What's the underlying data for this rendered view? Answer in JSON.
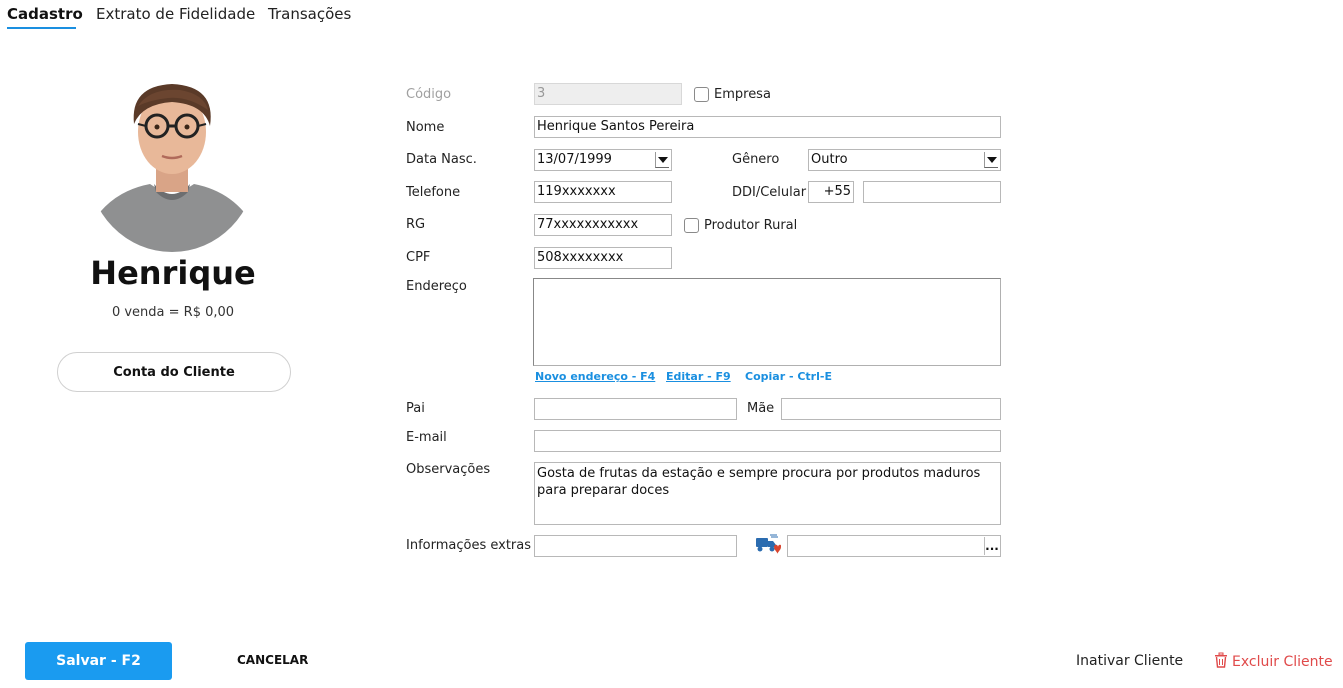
{
  "tabs": [
    {
      "label": "Cadastro",
      "active": true
    },
    {
      "label": "Extrato de Fidelidade",
      "active": false
    },
    {
      "label": "Transações",
      "active": false
    }
  ],
  "profile": {
    "name": "Henrique",
    "sales_summary": "0 venda = R$ 0,00",
    "account_button": "Conta do Cliente"
  },
  "form": {
    "codigo": {
      "label": "Código",
      "value": "3"
    },
    "empresa": {
      "label": "Empresa",
      "checked": false
    },
    "nome": {
      "label": "Nome",
      "value": "Henrique Santos Pereira"
    },
    "data_nasc": {
      "label": "Data Nasc.",
      "value": "13/07/1999"
    },
    "genero": {
      "label": "Gênero",
      "value": "Outro"
    },
    "telefone": {
      "label": "Telefone",
      "value": "119xxxxxxx"
    },
    "ddi_celular": {
      "label": "DDI/Celular",
      "ddi": "+55",
      "value": ""
    },
    "rg": {
      "label": "RG",
      "value": "77xxxxxxxxxxx"
    },
    "produtor_rural": {
      "label": "Produtor Rural",
      "checked": false
    },
    "cpf": {
      "label": "CPF",
      "value": "508xxxxxxxx"
    },
    "endereco": {
      "label": "Endereço",
      "value": "",
      "links": {
        "novo": "Novo endereço - F4",
        "editar": "Editar - F9",
        "copiar": "Copiar - Ctrl-E"
      }
    },
    "pai": {
      "label": "Pai",
      "value": ""
    },
    "mae": {
      "label": "Mãe",
      "value": ""
    },
    "email": {
      "label": "E-mail",
      "value": ""
    },
    "observacoes": {
      "label": "Observações",
      "value": "Gosta de frutas da estação e sempre procura por produtos maduros para preparar doces"
    },
    "info_extras": {
      "label": "Informações extras",
      "value": "",
      "extra_value": "",
      "ellipsis": "..."
    }
  },
  "footer": {
    "save": "Salvar - F2",
    "cancel": "CANCELAR",
    "inactivate": "Inativar Cliente",
    "delete": "Excluir Cliente"
  },
  "colors": {
    "accent": "#1a9bf0",
    "danger": "#e04a4a"
  }
}
